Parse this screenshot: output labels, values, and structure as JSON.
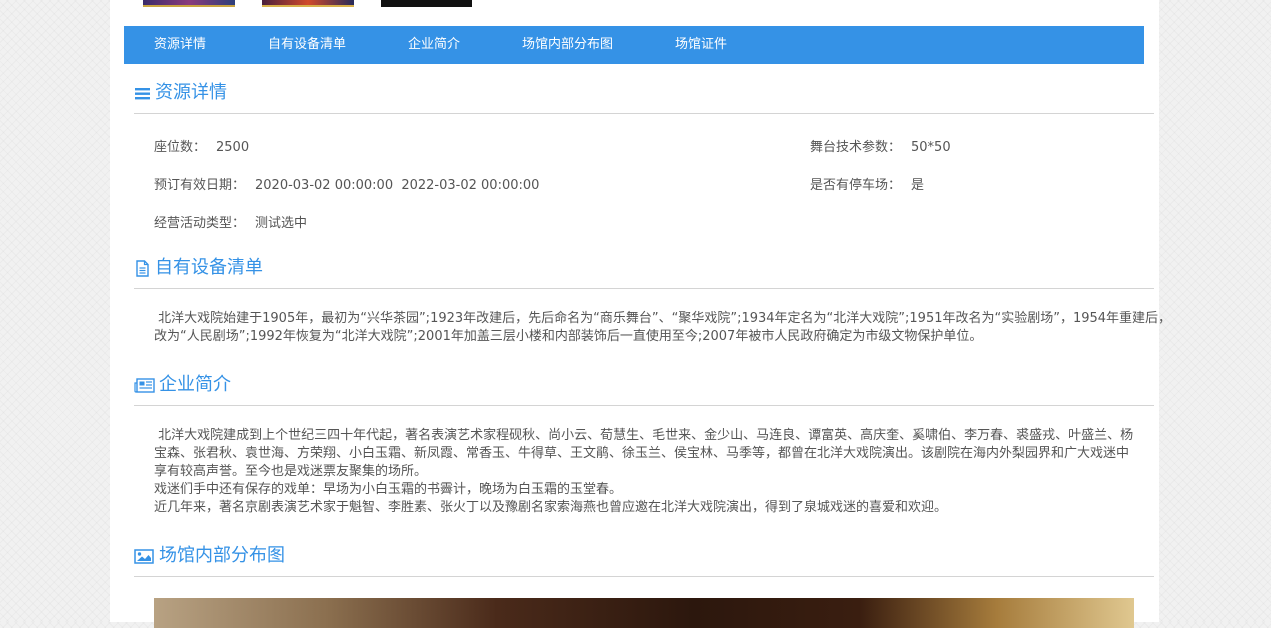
{
  "colors": {
    "accent": "#3592e6",
    "text": "#555555",
    "divider": "#d4d4d4"
  },
  "nav": {
    "items": [
      {
        "label": "资源详情"
      },
      {
        "label": "自有设备清单"
      },
      {
        "label": "企业简介"
      },
      {
        "label": "场馆内部分布图"
      },
      {
        "label": "场馆证件"
      }
    ]
  },
  "details": {
    "title": "资源详情",
    "icon": "list-icon",
    "seats_label": "座位数：",
    "seats_value": "2500",
    "stage_label": "舞台技术参数：",
    "stage_value": "50*50",
    "booking_label": "预订有效日期：",
    "booking_value": "2020-03-02 00:00:00  2022-03-02 00:00:00",
    "parking_label": "是否有停车场：",
    "parking_value": "是",
    "activity_label": "经营活动类型：",
    "activity_value": "测试选中"
  },
  "equipment": {
    "title": "自有设备清单",
    "icon": "document-icon",
    "line1": " 北洋大戏院始建于1905年，最初为“兴华茶园”;1923年改建后，先后命名为“商乐舞台”、“聚华戏院”;1934年定名为“北洋大戏院”;1951年改名为“实验剧场”，1954年重建后，",
    "line2": "改为“人民剧场”;1992年恢复为“北洋大戏院”;2001年加盖三层小楼和内部装饰后一直使用至今;2007年被市人民政府确定为市级文物保护单位。"
  },
  "company": {
    "title": "企业简介",
    "icon": "newspaper-icon",
    "line1": " 北洋大戏院建成到上个世纪三四十年代起，著名表演艺术家程砚秋、尚小云、荀慧生、毛世来、金少山、马连良、谭富英、高庆奎、奚啸伯、李万春、裘盛戎、叶盛兰、杨",
    "line2": "宝森、张君秋、袁世海、方荣翔、小白玉霜、新凤霞、常香玉、牛得草、王文鹃、徐玉兰、侯宝林、马季等，都曾在北洋大戏院演出。该剧院在海内外梨园界和广大戏迷中",
    "line3": "享有较高声誉。至今也是戏迷票友聚集的场所。",
    "line4": "戏迷们手中还有保存的戏单：早场为小白玉霜的书霽计，晚场为白玉霜的玉堂春。",
    "line5": "近几年来，著名京剧表演艺术家于魁智、李胜素、张火丁以及豫剧名家索海燕也曾应邀在北洋大戏院演出，得到了泉城戏迷的喜爱和欢迎。"
  },
  "layout_map": {
    "title": "场馆内部分布图",
    "icon": "image-icon"
  }
}
